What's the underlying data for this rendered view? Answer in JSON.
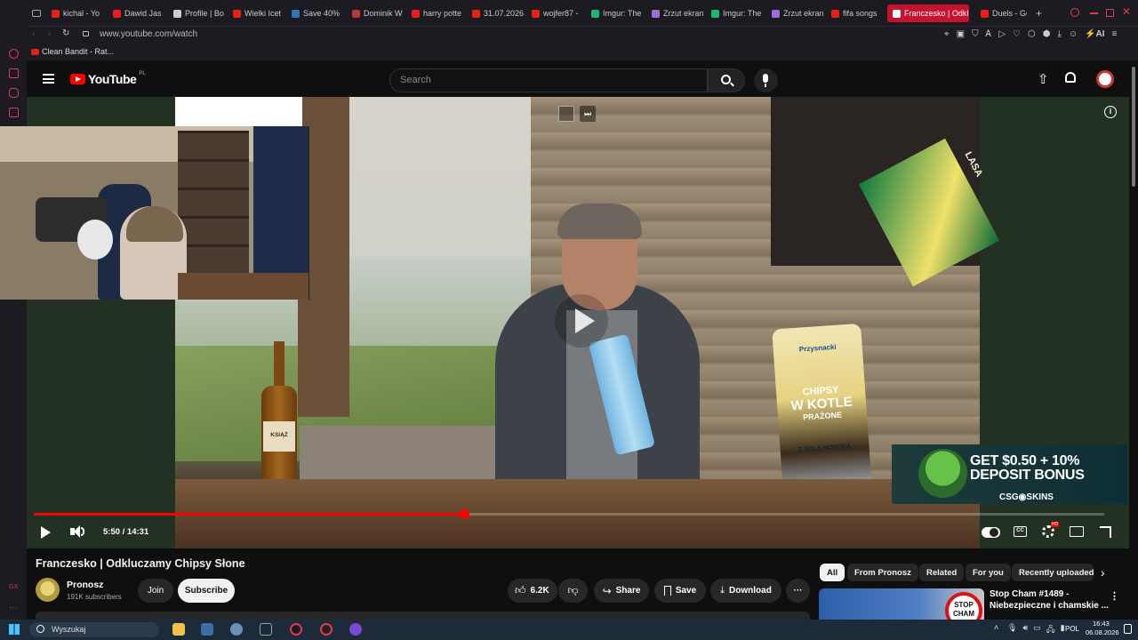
{
  "browser": {
    "tabs": [
      {
        "label": "kichal - Yo",
        "color": "#e62117"
      },
      {
        "label": "Dawid Jas",
        "color": "#e62117"
      },
      {
        "label": "Profile | Bo",
        "color": "#cccccc"
      },
      {
        "label": "Wielki Icet",
        "color": "#e62117"
      },
      {
        "label": "Save 40%",
        "color": "#2a75bb"
      },
      {
        "label": "Dominik W",
        "color": "#b63a3a"
      },
      {
        "label": "harry potte",
        "color": "#e62117"
      },
      {
        "label": "31.07.2026",
        "color": "#e62117"
      },
      {
        "label": "wojfer87 -",
        "color": "#e62117"
      },
      {
        "label": "Imgur: The",
        "color": "#1bb76e"
      },
      {
        "label": "Zrzut ekran",
        "color": "#9f6bd6"
      },
      {
        "label": "Imgur: The",
        "color": "#1bb76e"
      },
      {
        "label": "Zrzut ekran",
        "color": "#9f6bd6"
      },
      {
        "label": "fifa songs",
        "color": "#e62117"
      },
      {
        "label": "Franczesko | Odklu",
        "color": "#ffffff",
        "active": true
      },
      {
        "label": "Duels - Ge",
        "color": "#e62117"
      }
    ],
    "url": "www.youtube.com/watch",
    "bookmark": "Clean Bandit - Rat..."
  },
  "youtube": {
    "logo_text": "YouTube",
    "logo_region": "PL",
    "search_placeholder": "Search"
  },
  "player": {
    "time_label": "5:50 / 14:31",
    "progress": 0.4023,
    "ad_line1": "GET $0.50 + 10%",
    "ad_line2": "DEPOSIT BONUS",
    "ad_brand": "CSG◉SKINS",
    "bottle_label": "KSIĄŻ",
    "chips_brand": "Przysnacki",
    "chips_line1": "CHIPSY",
    "chips_line2": "W KOTLE",
    "chips_line3": "PRAŻONE",
    "chips_flavor": "Z SOLĄ MORSKĄ",
    "box_label": "LASA",
    "settings_badge": "HD"
  },
  "video": {
    "title": "Franczesko | Odkluczamy Chipsy Słone",
    "channel": "Pronosz",
    "subscribers": "191K subscribers",
    "join_label": "Join",
    "subscribe_label": "Subscribe",
    "likes": "6.2K",
    "share_label": "Share",
    "save_label": "Save",
    "download_label": "Download"
  },
  "chips": [
    "All",
    "From Pronosz",
    "Related",
    "For you",
    "Recently uploaded"
  ],
  "recommended": {
    "title_line1": "Stop Cham #1489 -",
    "title_line2": "Niebezpieczne i chamskie ...",
    "thumb_text_1": "STOP",
    "thumb_text_2": "CHAM"
  },
  "taskbar": {
    "search_label": "Wyszukaj",
    "language": "POL",
    "time": "16:43",
    "date": "06.08.2026",
    "gx_label": "GX"
  }
}
